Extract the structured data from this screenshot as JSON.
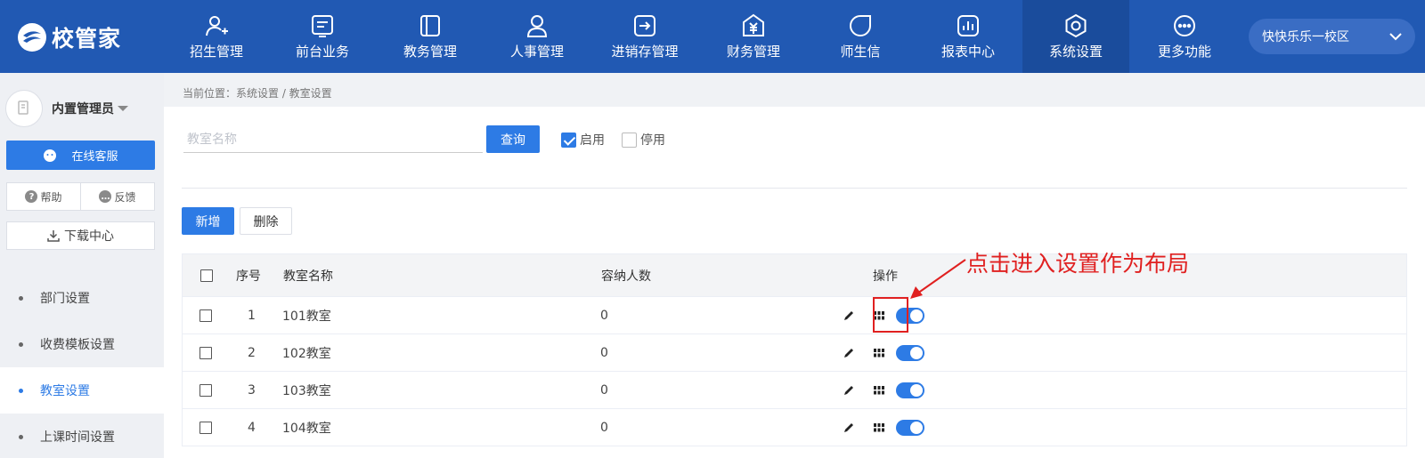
{
  "brand": {
    "name": "校管家"
  },
  "nav": {
    "items": [
      {
        "label": "招生管理",
        "icon": "user-add-icon"
      },
      {
        "label": "前台业务",
        "icon": "reception-icon"
      },
      {
        "label": "教务管理",
        "icon": "book-icon"
      },
      {
        "label": "人事管理",
        "icon": "person-icon"
      },
      {
        "label": "进销存管理",
        "icon": "inventory-icon"
      },
      {
        "label": "财务管理",
        "icon": "finance-icon"
      },
      {
        "label": "师生信",
        "icon": "message-icon"
      },
      {
        "label": "报表中心",
        "icon": "report-icon"
      },
      {
        "label": "系统设置",
        "icon": "settings-icon",
        "active": true
      },
      {
        "label": "更多功能",
        "icon": "more-icon"
      }
    ],
    "campus": "快快乐乐一校区"
  },
  "sidebar": {
    "user_name": "内置管理员",
    "service_label": "在线客服",
    "help_label": "帮助",
    "feedback_label": "反馈",
    "download_label": "下载中心",
    "menu": [
      {
        "label": "部门设置"
      },
      {
        "label": "收费模板设置"
      },
      {
        "label": "教室设置",
        "active": true
      },
      {
        "label": "上课时间设置"
      }
    ]
  },
  "breadcrumb": "当前位置：系统设置 / 教室设置",
  "filter": {
    "placeholder": "教室名称",
    "query_label": "查询",
    "enabled_label": "启用",
    "enabled_checked": true,
    "disabled_label": "停用",
    "disabled_checked": false
  },
  "actions": {
    "add_label": "新增",
    "delete_label": "删除"
  },
  "table": {
    "headers": {
      "index": "序号",
      "name": "教室名称",
      "capacity": "容纳人数",
      "ops": "操作"
    },
    "rows": [
      {
        "index": "1",
        "name": "101教室",
        "capacity": "0",
        "enabled": true
      },
      {
        "index": "2",
        "name": "102教室",
        "capacity": "0",
        "enabled": true
      },
      {
        "index": "3",
        "name": "103教室",
        "capacity": "0",
        "enabled": true
      },
      {
        "index": "4",
        "name": "104教室",
        "capacity": "0",
        "enabled": true
      }
    ]
  },
  "annotation": "点击进入设置作为布局",
  "colors": {
    "nav_bg": "#2159b3",
    "accent": "#2d7be5",
    "annotation": "#e02020"
  }
}
